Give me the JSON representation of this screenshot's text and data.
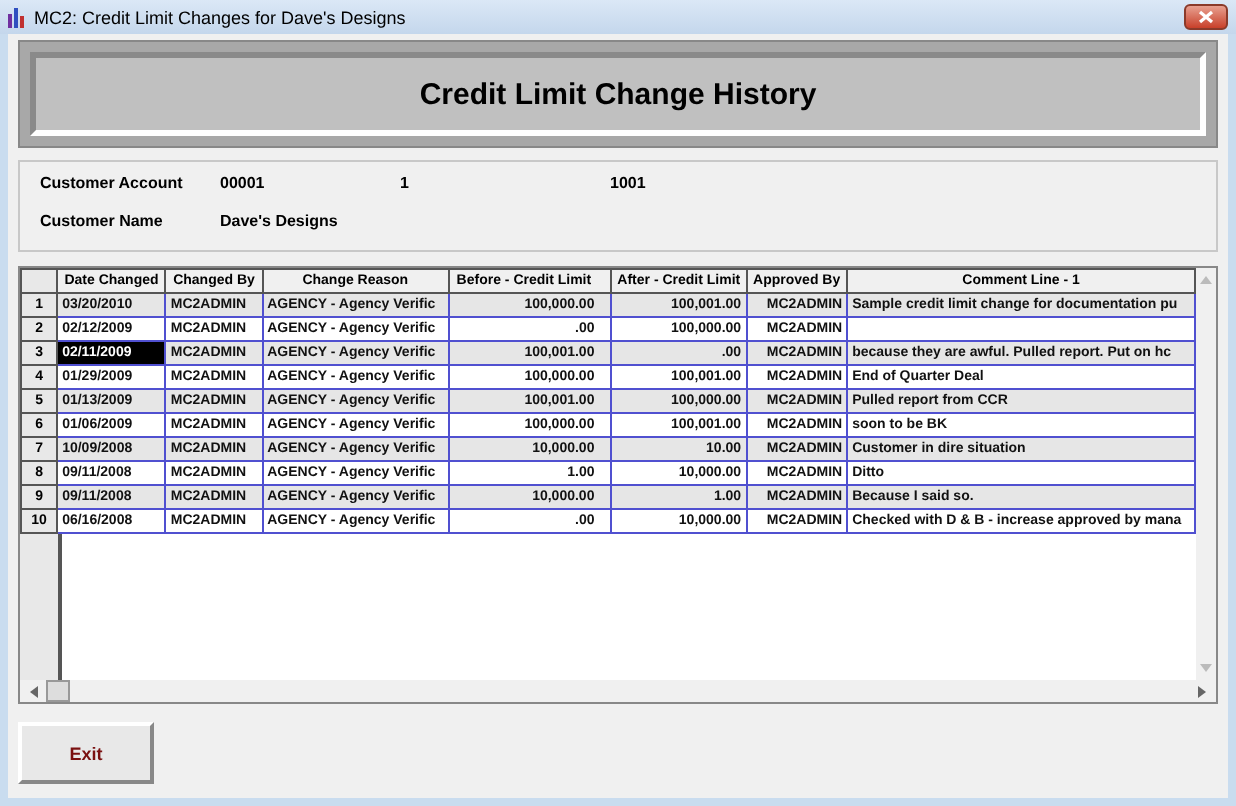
{
  "window": {
    "title": "MC2: Credit Limit Changes for Dave's Designs"
  },
  "header": {
    "title": "Credit Limit Change History"
  },
  "customer": {
    "account_label": "Customer Account",
    "account": "00001",
    "account_2": "1",
    "account_3": "1001",
    "name_label": "Customer Name",
    "name": "Dave's Designs"
  },
  "table": {
    "columns": [
      "Date Changed",
      "Changed By",
      "Change Reason",
      "Before - Credit Limit",
      "After - Credit Limit",
      "Approved By",
      "Comment Line - 1"
    ],
    "rows": [
      {
        "number": "1",
        "selected": false,
        "cells": [
          "03/20/2010",
          "MC2ADMIN",
          "AGENCY - Agency Verific",
          "100,000.00",
          "100,001.00",
          "MC2ADMIN",
          "Sample credit limit change for documentation pu"
        ]
      },
      {
        "number": "2",
        "selected": false,
        "cells": [
          "02/12/2009",
          "MC2ADMIN",
          "AGENCY - Agency Verific",
          ".00",
          "100,000.00",
          "MC2ADMIN"
        ]
      },
      {
        "number": "3",
        "selected": true,
        "cells": [
          "02/11/2009",
          "MC2ADMIN",
          "AGENCY - Agency Verific",
          "100,001.00",
          ".00",
          "MC2ADMIN",
          "because they are awful.  Pulled report.  Put on hc"
        ]
      },
      {
        "number": "4",
        "selected": false,
        "cells": [
          "01/29/2009",
          "MC2ADMIN",
          "AGENCY - Agency Verific",
          "100,000.00",
          "100,001.00",
          "MC2ADMIN",
          "End of Quarter Deal"
        ]
      },
      {
        "number": "5",
        "selected": false,
        "cells": [
          "01/13/2009",
          "MC2ADMIN",
          "AGENCY - Agency Verific",
          "100,001.00",
          "100,000.00",
          "MC2ADMIN",
          "Pulled report from CCR"
        ]
      },
      {
        "number": "6",
        "selected": false,
        "cells": [
          "01/06/2009",
          "MC2ADMIN",
          "AGENCY - Agency Verific",
          "100,000.00",
          "100,001.00",
          "MC2ADMIN",
          "soon to be BK"
        ]
      },
      {
        "number": "7",
        "selected": false,
        "cells": [
          "10/09/2008",
          "MC2ADMIN",
          "AGENCY - Agency Verific",
          "10,000.00",
          "10.00",
          "MC2ADMIN",
          "Customer in dire situation"
        ]
      },
      {
        "number": "8",
        "selected": false,
        "cells": [
          "09/11/2008",
          "MC2ADMIN",
          "AGENCY - Agency Verific",
          "1.00",
          "10,000.00",
          "MC2ADMIN",
          "Ditto"
        ]
      },
      {
        "number": "9",
        "selected": false,
        "cells": [
          "09/11/2008",
          "MC2ADMIN",
          "AGENCY - Agency Verific",
          "10,000.00",
          "1.00",
          "MC2ADMIN",
          "Because I said so."
        ]
      },
      {
        "number": "10",
        "selected": false,
        "cells": [
          "06/16/2008",
          "MC2ADMIN",
          "AGENCY - Agency Verific",
          ".00",
          "10,000.00",
          "MC2ADMIN",
          "Checked with D & B - increase approved by mana"
        ]
      }
    ]
  },
  "buttons": [
    "Exit"
  ]
}
